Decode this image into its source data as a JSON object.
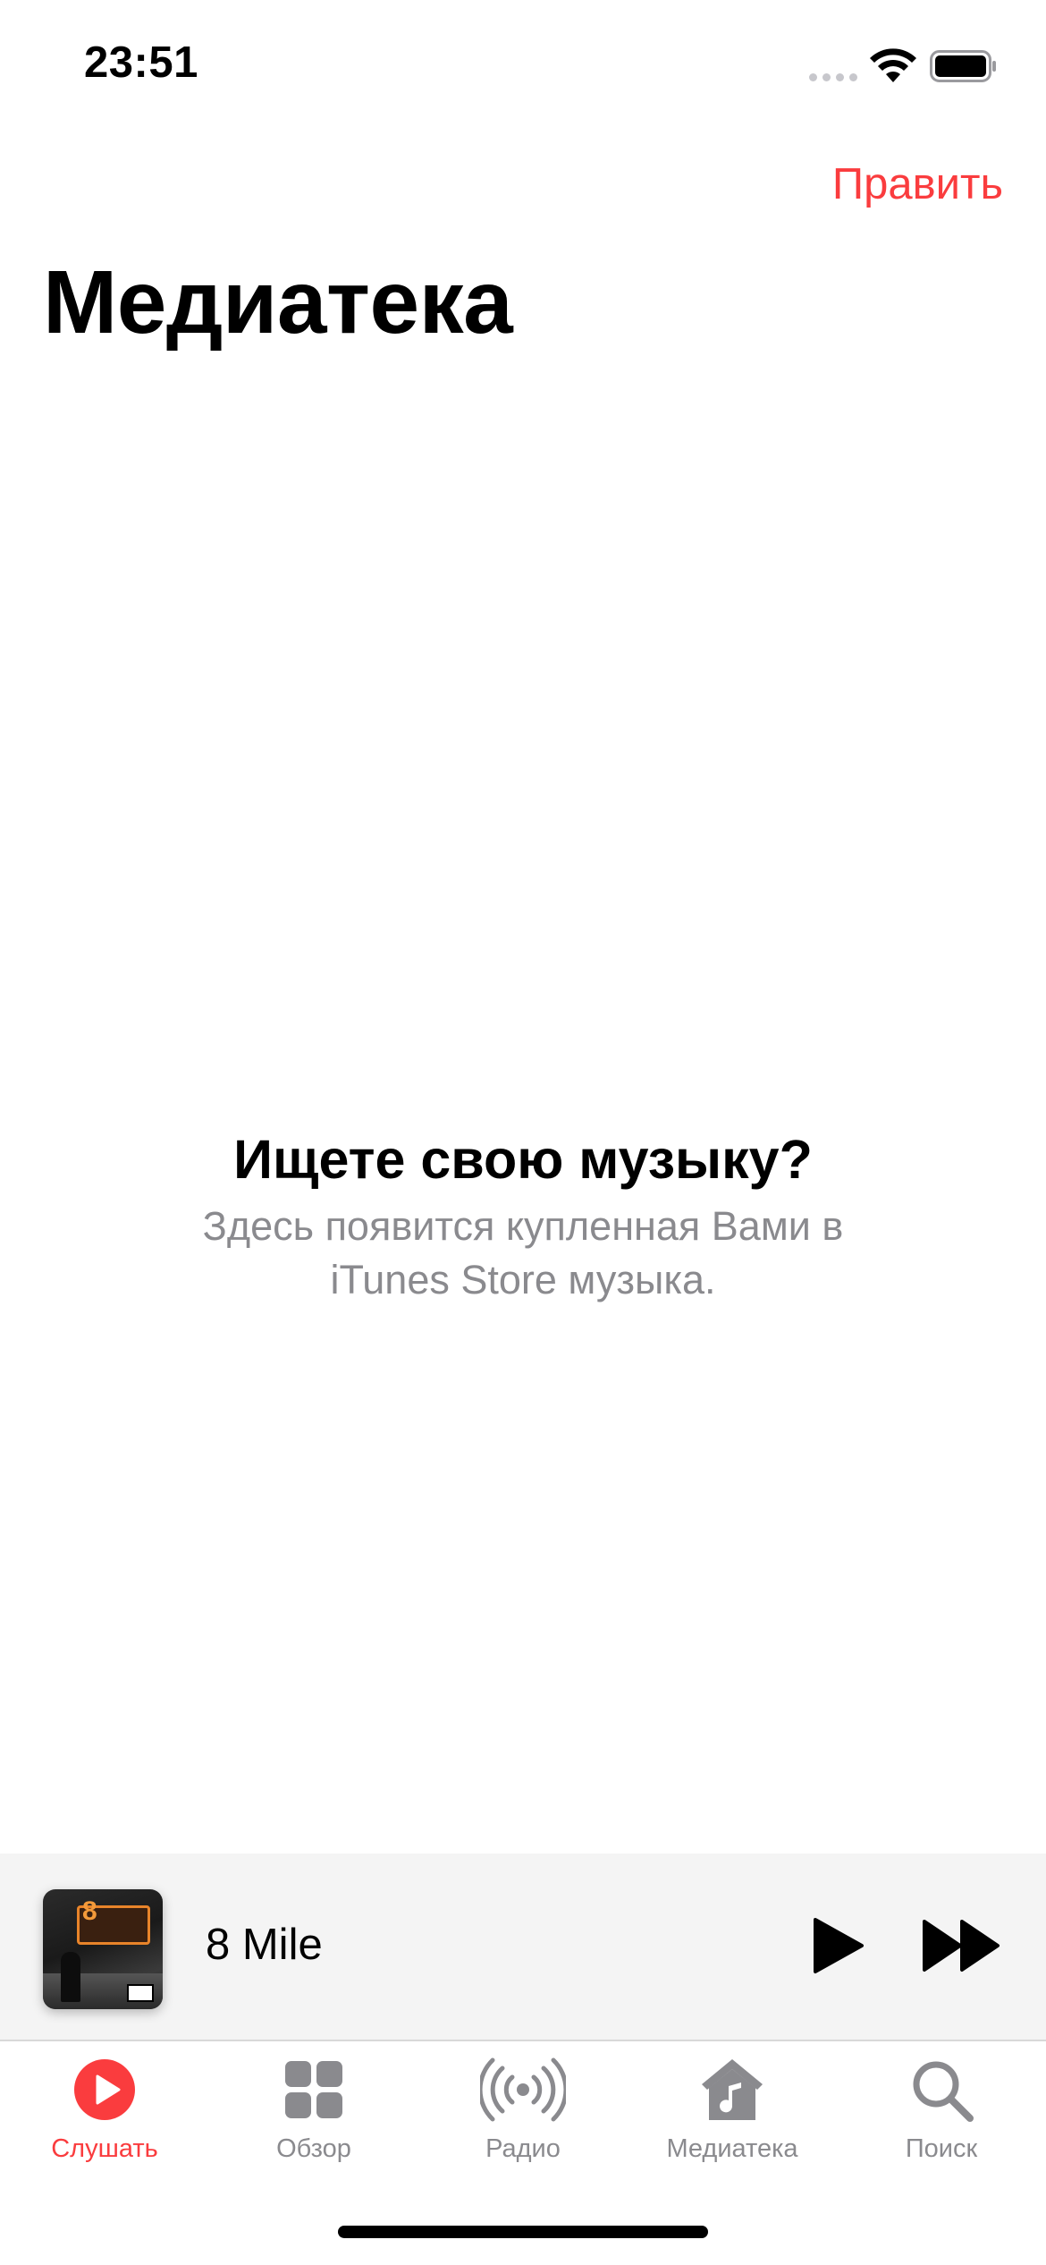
{
  "status_bar": {
    "time": "23:51",
    "icons": [
      "signal-icon",
      "wifi-icon",
      "battery-icon"
    ]
  },
  "nav": {
    "edit_label": "Править",
    "title": "Медиатека"
  },
  "empty_state": {
    "title": "Ищете свою музыку?",
    "subtitle": "Здесь появится купленная Вами в iTunes Store музыка."
  },
  "mini_player": {
    "track_title": "8 Mile",
    "artwork_text": "8"
  },
  "tabs": [
    {
      "label": "Слушать",
      "icon": "play-circle-icon",
      "active": true
    },
    {
      "label": "Обзор",
      "icon": "grid-icon",
      "active": false
    },
    {
      "label": "Радио",
      "icon": "radio-icon",
      "active": false
    },
    {
      "label": "Медиатека",
      "icon": "library-icon",
      "active": false
    },
    {
      "label": "Поиск",
      "icon": "search-icon",
      "active": false
    }
  ],
  "colors": {
    "accent": "#fa3c3e",
    "inactive": "#8a8a8e",
    "player_bg": "#f4f4f4"
  }
}
